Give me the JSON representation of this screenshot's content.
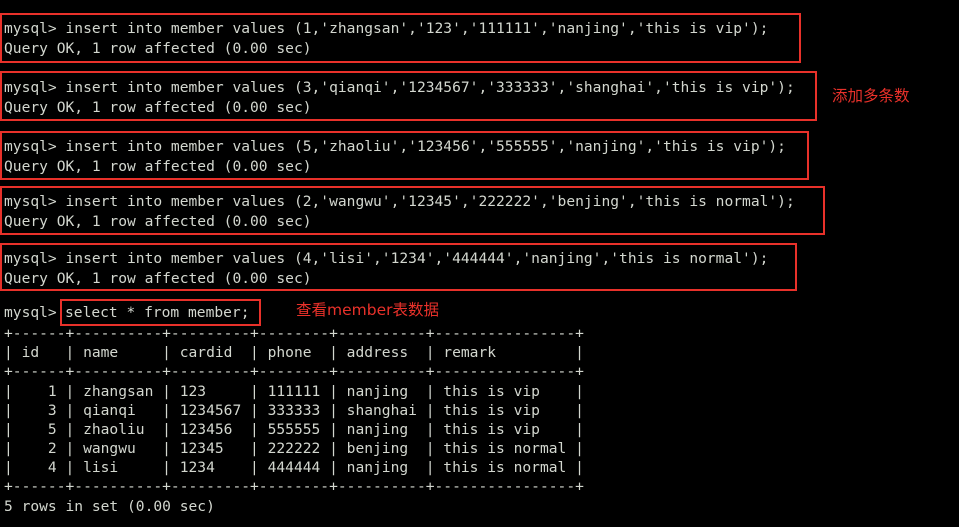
{
  "terminal": {
    "prompt": "mysql> ",
    "blocks": [
      {
        "command": "mysql> insert into member values (1,'zhangsan','123','111111','nanjing','this is vip');",
        "result": "Query OK, 1 row affected (0.00 sec)"
      },
      {
        "command": "mysql> insert into member values (3,'qianqi','1234567','333333','shanghai','this is vip');",
        "result": "Query OK, 1 row affected (0.00 sec)"
      },
      {
        "command": "mysql> insert into member values (5,'zhaoliu','123456','555555','nanjing','this is vip');",
        "result": "Query OK, 1 row affected (0.00 sec)"
      },
      {
        "command": "mysql> insert into member values (2,'wangwu','12345','222222','benjing','this is normal');",
        "result": "Query OK, 1 row affected (0.00 sec)"
      },
      {
        "command": "mysql> insert into member values (4,'lisi','1234','444444','nanjing','this is normal');",
        "result": "Query OK, 1 row affected (0.00 sec)"
      }
    ],
    "select_prompt": "mysql> ",
    "select_command": "select * from member;",
    "table": {
      "rule": "+------+----------+---------+--------+----------+----------------+",
      "header_row": "| id   | name     | cardid  | phone  | address  | remark         |",
      "columns": [
        "id",
        "name",
        "cardid",
        "phone",
        "address",
        "remark"
      ],
      "rows": [
        [
          "1",
          "zhangsan",
          "123",
          "111111",
          "nanjing",
          "this is vip"
        ],
        [
          "3",
          "qianqi",
          "1234567",
          "333333",
          "shanghai",
          "this is vip"
        ],
        [
          "5",
          "zhaoliu",
          "123456",
          "555555",
          "nanjing",
          "this is vip"
        ],
        [
          "2",
          "wangwu",
          "12345",
          "222222",
          "benjing",
          "this is normal"
        ],
        [
          "4",
          "lisi",
          "1234",
          "444444",
          "nanjing",
          "this is normal"
        ]
      ],
      "rendered_rows": [
        "|    1 | zhangsan | 123     | 111111 | nanjing  | this is vip    |",
        "|    3 | qianqi   | 1234567 | 333333 | shanghai | this is vip    |",
        "|    5 | zhaoliu  | 123456  | 555555 | nanjing  | this is vip    |",
        "|    2 | wangwu   | 12345   | 222222 | benjing  | this is normal |",
        "|    4 | lisi     | 1234    | 444444 | nanjing  | this is normal |"
      ],
      "footer": "5 rows in set (0.00 sec)"
    }
  },
  "annotations": {
    "insert_note": "添加多条数",
    "select_note": "查看member表数据",
    "highlight_color": "#e8312a"
  }
}
